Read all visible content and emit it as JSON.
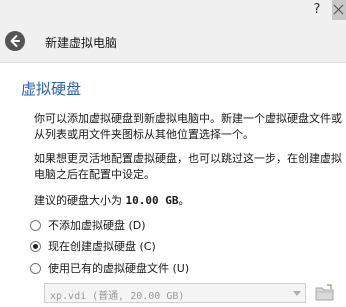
{
  "window": {
    "help_label": "?"
  },
  "header": {
    "title": "新建虚拟电脑"
  },
  "page": {
    "title": "虚拟硬盘",
    "para1": "你可以添加虚拟硬盘到新虚拟电脑中。新建一个虚拟硬盘文件或从列表或用文件夹图标从其他位置选择一个。",
    "para2": "如果想更灵活地配置虚拟硬盘，也可以跳过这一步，在创建虚拟电脑之后在配置中设定。",
    "size_prefix": "建议的硬盘大小为",
    "size_value": "10.00 GB",
    "size_suffix": "。"
  },
  "options": [
    {
      "label": "不添加虚拟硬盘 (D)",
      "checked": false
    },
    {
      "label": "现在创建虚拟硬盘 (C)",
      "checked": true
    },
    {
      "label": "使用已有的虚拟硬盘文件 (U)",
      "checked": false
    }
  ],
  "file_select": {
    "value": "xp.vdi (普通, 20.00 GB)"
  },
  "icons": {
    "back": "back-arrow-icon",
    "close": "close-icon",
    "folder": "folder-icon"
  },
  "colors": {
    "accent_title": "#2a62b6",
    "header_bg": "#f0f0f0"
  }
}
